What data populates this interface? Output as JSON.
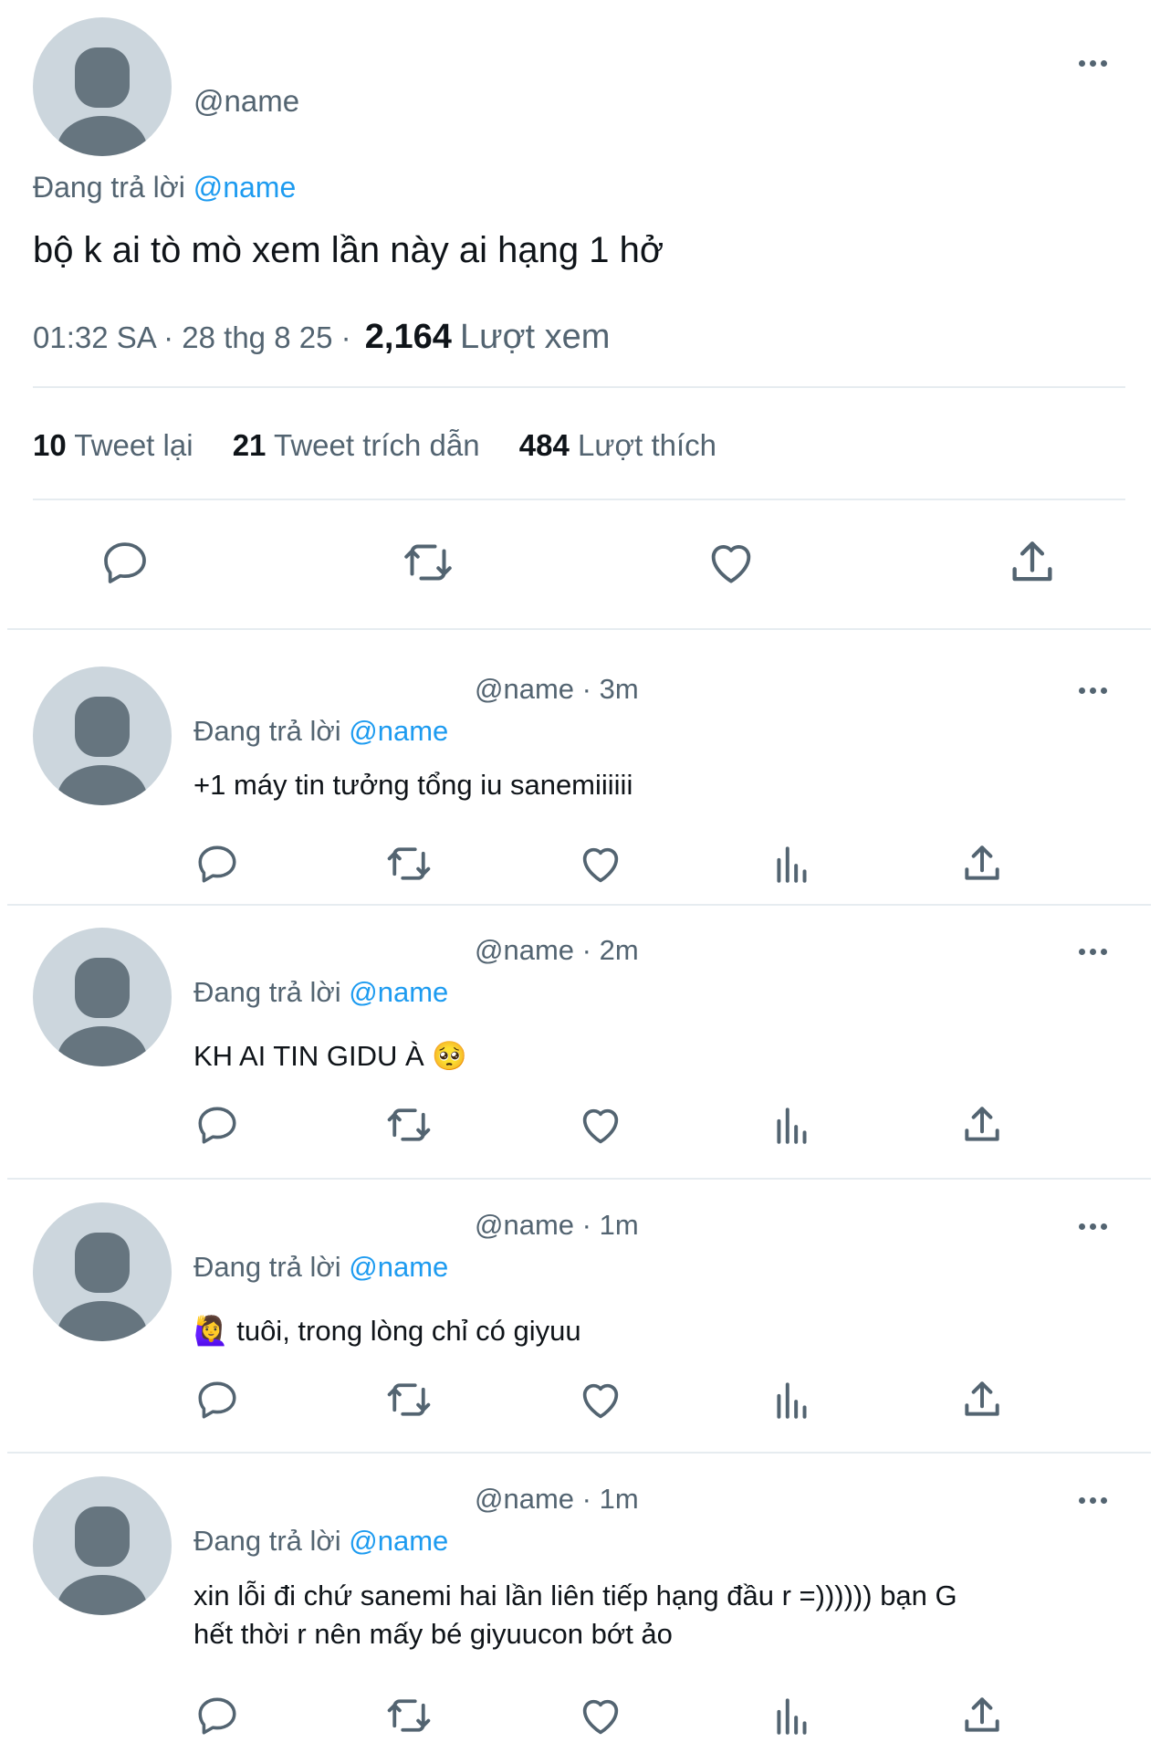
{
  "main_tweet": {
    "handle": "@name",
    "replying_prefix": "Đang trả lời",
    "replying_to": "@name",
    "text": "bộ k ai tò mò xem lần này ai hạng 1 hở",
    "time": "01:32 SA · 28 thg 8 25 ·",
    "views_count": "2,164",
    "views_label": "Lượt xem",
    "retweets_count": "10",
    "retweets_label": "Tweet lại",
    "quotes_count": "21",
    "quotes_label": "Tweet trích dẫn",
    "likes_count": "484",
    "likes_label": "Lượt thích"
  },
  "replies": [
    {
      "handle": "@name",
      "time": "· 3m",
      "replying_prefix": "Đang trả lời",
      "replying_to": "@name",
      "text": "+1 máy tin tưởng tổng iu sanemiiiiii"
    },
    {
      "handle": "@name",
      "time": "· 2m",
      "replying_prefix": "Đang trả lời",
      "replying_to": "@name",
      "text": "KH AI TIN GIDU À 🥺"
    },
    {
      "handle": "@name",
      "time": "· 1m",
      "replying_prefix": "Đang trả lời",
      "replying_to": "@name",
      "text": "🙋‍♀️ tuôi, trong lòng chỉ có giyuu"
    },
    {
      "handle": "@name",
      "time": "· 1m",
      "replying_prefix": "Đang trả lời",
      "replying_to": "@name",
      "text_line1": "xin lỗi đi chứ sanemi hai lần liên tiếp hạng đầu r =)))))) bạn G",
      "text_line2": "hết thời r nên mấy bé giyuucon bớt ảo"
    }
  ],
  "colors": {
    "link": "#1d9bf0",
    "icon": "#536471",
    "avatar_bg": "#ccd6dd",
    "avatar_fg": "#66757f"
  }
}
